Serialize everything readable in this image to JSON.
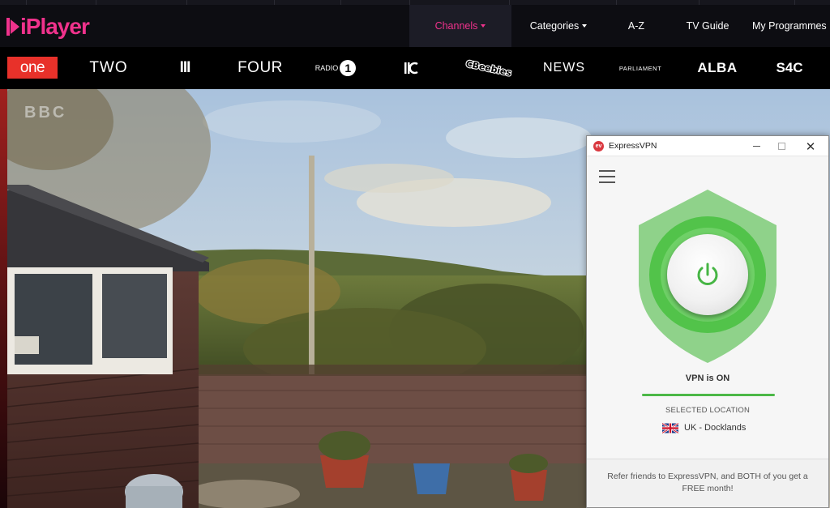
{
  "header": {
    "logo_text": "iPlayer",
    "nav": [
      {
        "label": "Channels",
        "active": true,
        "dropdown": true
      },
      {
        "label": "Categories",
        "active": false,
        "dropdown": true
      },
      {
        "label": "A-Z",
        "active": false,
        "dropdown": false
      },
      {
        "label": "TV Guide",
        "active": false,
        "dropdown": false
      },
      {
        "label": "My Programmes",
        "active": false,
        "dropdown": false
      }
    ],
    "accent_color": "#f0328c"
  },
  "channels": {
    "one": "one",
    "two": "TWO",
    "three": "III",
    "four": "FOUR",
    "radio": "RADIO",
    "radio_num": "1",
    "cbbc": "CBBC",
    "cbeebies": "CBeebies",
    "news": "NEWS",
    "parliament": "PARLIAMENT",
    "alba": "ALBA",
    "s4c": "S4C"
  },
  "video": {
    "watermark": "BBC"
  },
  "vpn": {
    "title": "ExpressVPN",
    "icon_text": "ev",
    "status": "VPN is ON",
    "location_label": "SELECTED LOCATION",
    "location_name": "UK - Docklands",
    "location_flag": "uk-flag-icon",
    "footer_text": "Refer friends to ExpressVPN, and BOTH of you get a FREE month!",
    "status_color": "#4cb847"
  }
}
